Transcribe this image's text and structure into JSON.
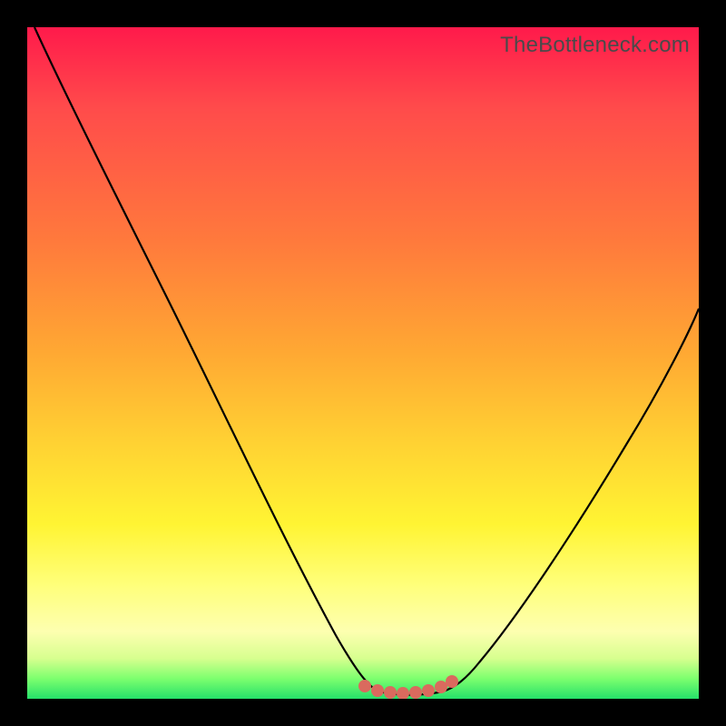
{
  "watermark": "TheBottleneck.com",
  "chart_data": {
    "type": "line",
    "title": "",
    "xlabel": "",
    "ylabel": "",
    "xlim": [
      0,
      100
    ],
    "ylim": [
      0,
      100
    ],
    "grid": false,
    "series": [
      {
        "name": "left-slope",
        "x": [
          0,
          8,
          18,
          28,
          38,
          45,
          49,
          52
        ],
        "y": [
          100,
          88,
          72,
          54,
          34,
          16,
          6,
          1
        ]
      },
      {
        "name": "valley-floor",
        "x": [
          50,
          54,
          58,
          62
        ],
        "y": [
          1,
          0.5,
          0.5,
          1
        ]
      },
      {
        "name": "right-slope",
        "x": [
          62,
          66,
          72,
          80,
          90,
          100
        ],
        "y": [
          2,
          8,
          20,
          36,
          54,
          70
        ]
      }
    ],
    "markers": {
      "name": "valley-points",
      "x": [
        50,
        52,
        54,
        56,
        58,
        60,
        62
      ],
      "y": [
        2,
        1.2,
        0.8,
        0.7,
        0.8,
        1.2,
        2
      ],
      "color": "#da6a5e"
    },
    "background_gradient": {
      "top": "#ff1a4b",
      "mid": "#ffd233",
      "bottom": "#25e06a"
    }
  }
}
